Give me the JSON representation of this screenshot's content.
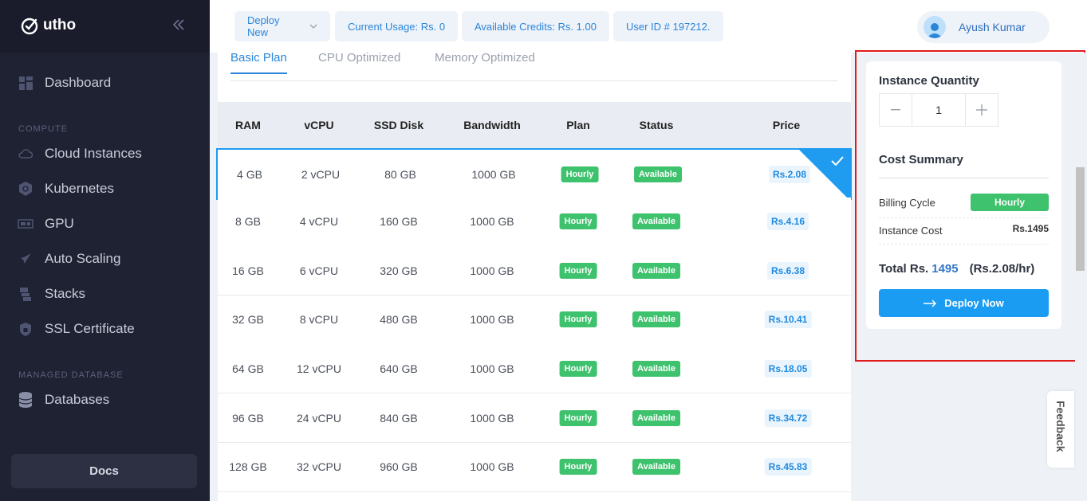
{
  "brand": {
    "name": "utho"
  },
  "sidebar": {
    "collapse_icon": "double-chevron-left-icon",
    "dashboard": "Dashboard",
    "sections": {
      "compute": "COMPUTE",
      "managed_database": "MANAGED DATABASE"
    },
    "compute_items": [
      {
        "label": "Cloud Instances",
        "icon": "cloud-icon"
      },
      {
        "label": "Kubernetes",
        "icon": "kubernetes-icon"
      },
      {
        "label": "GPU",
        "icon": "gpu-icon"
      },
      {
        "label": "Auto Scaling",
        "icon": "rocket-icon"
      },
      {
        "label": "Stacks",
        "icon": "stacks-icon"
      },
      {
        "label": "SSL Certificate",
        "icon": "lock-icon"
      }
    ],
    "db_items": [
      {
        "label": "Databases",
        "icon": "database-icon"
      }
    ],
    "docs": "Docs"
  },
  "topbar": {
    "deploy_new": "Deploy New",
    "current_usage": "Current Usage: Rs. 0",
    "available_credits": "Available Credits: Rs. 1.00",
    "user_id": "User ID # 197212.",
    "user_name": "Ayush Kumar"
  },
  "tabs": [
    "Basic Plan",
    "CPU Optimized",
    "Memory Optimized"
  ],
  "table": {
    "headers": [
      "RAM",
      "vCPU",
      "SSD Disk",
      "Bandwidth",
      "Plan",
      "Status",
      "Price"
    ],
    "rows": [
      {
        "ram": "4 GB",
        "vcpu": "2 vCPU",
        "ssd": "80 GB",
        "bandwidth": "1000 GB",
        "plan": "Hourly",
        "status": "Available",
        "price": "Rs.2.08"
      },
      {
        "ram": "8 GB",
        "vcpu": "4 vCPU",
        "ssd": "160 GB",
        "bandwidth": "1000 GB",
        "plan": "Hourly",
        "status": "Available",
        "price": "Rs.4.16"
      },
      {
        "ram": "16 GB",
        "vcpu": "6 vCPU",
        "ssd": "320 GB",
        "bandwidth": "1000 GB",
        "plan": "Hourly",
        "status": "Available",
        "price": "Rs.6.38"
      },
      {
        "ram": "32 GB",
        "vcpu": "8 vCPU",
        "ssd": "480 GB",
        "bandwidth": "1000 GB",
        "plan": "Hourly",
        "status": "Available",
        "price": "Rs.10.41"
      },
      {
        "ram": "64 GB",
        "vcpu": "12 vCPU",
        "ssd": "640 GB",
        "bandwidth": "1000 GB",
        "plan": "Hourly",
        "status": "Available",
        "price": "Rs.18.05"
      },
      {
        "ram": "96 GB",
        "vcpu": "24 vCPU",
        "ssd": "840 GB",
        "bandwidth": "1000 GB",
        "plan": "Hourly",
        "status": "Available",
        "price": "Rs.34.72"
      },
      {
        "ram": "128 GB",
        "vcpu": "32 vCPU",
        "ssd": "960 GB",
        "bandwidth": "1000 GB",
        "plan": "Hourly",
        "status": "Available",
        "price": "Rs.45.83"
      }
    ]
  },
  "summary": {
    "instance_quantity_title": "Instance Quantity",
    "quantity": "1",
    "cost_summary_title": "Cost Summary",
    "billing_cycle_label": "Billing Cycle",
    "billing_cycle_value": "Hourly",
    "instance_cost_label": "Instance Cost",
    "instance_cost_value": "Rs.1495",
    "total_label": "Total Rs.",
    "total_amount": "1495",
    "total_hourly": "(Rs.2.08/hr)",
    "deploy_now": "Deploy Now"
  },
  "feedback": "Feedback",
  "colors": {
    "accent": "#1a9cf2",
    "success": "#3ec26d",
    "sidebar": "#1f2233",
    "highlight_outline": "#e01b1b"
  }
}
